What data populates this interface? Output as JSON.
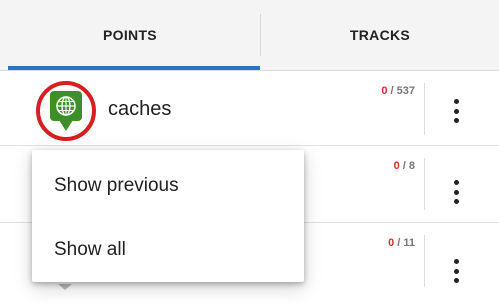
{
  "tabs": [
    {
      "label": "POINTS",
      "active": true
    },
    {
      "label": "TRACKS",
      "active": false
    }
  ],
  "rows": [
    {
      "name": "caches",
      "count_zero": "0",
      "count_sep": " / ",
      "count_total": "537",
      "icon": "geocache-globe-icon"
    },
    {
      "name": "",
      "count_zero": "0",
      "count_sep": " / ",
      "count_total": "8",
      "icon": ""
    },
    {
      "name": "",
      "count_zero": "0",
      "count_sep": " / ",
      "count_total": "11",
      "icon": ""
    }
  ],
  "popup_menu": {
    "items": [
      {
        "label": "Show previous"
      },
      {
        "label": "Show all"
      }
    ]
  },
  "colors": {
    "accent": "#2a72c8",
    "highlight_ring": "#d61f1f",
    "count_zero": "#d32f2f",
    "icon_green": "#3d8f2a"
  }
}
